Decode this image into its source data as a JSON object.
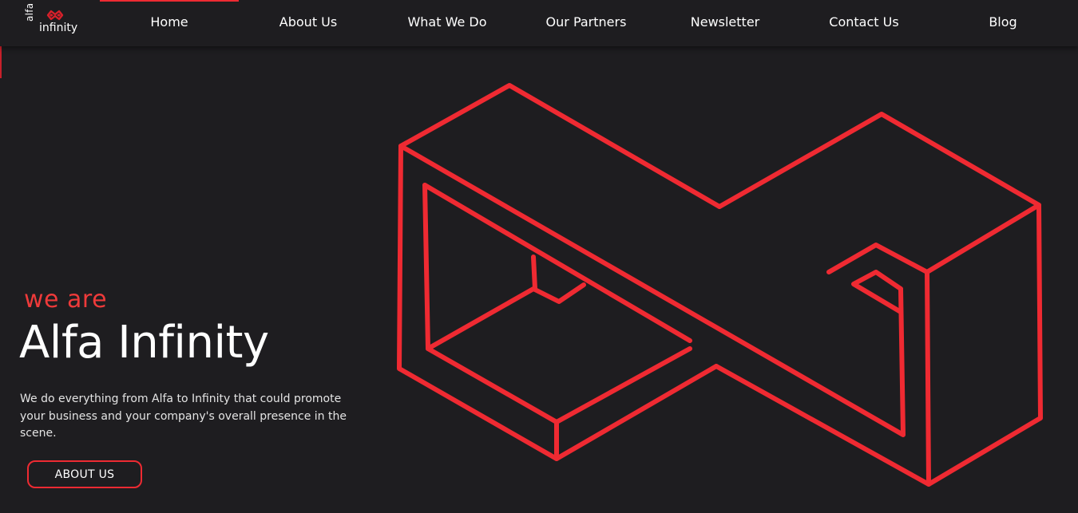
{
  "brand": {
    "logo_top": "alfa",
    "logo_bottom": "infinity",
    "accent_color": "#ee2a32",
    "background_color": "#1e1d20",
    "logo_icon": "infinity-icon"
  },
  "nav": {
    "items": [
      {
        "label": "Home",
        "active": true
      },
      {
        "label": "About Us",
        "active": false
      },
      {
        "label": "What We Do",
        "active": false
      },
      {
        "label": "Our Partners",
        "active": false
      },
      {
        "label": "Newsletter",
        "active": false
      },
      {
        "label": "Contact Us",
        "active": false
      },
      {
        "label": "Blog",
        "active": false
      }
    ]
  },
  "hero": {
    "eyebrow": "we are",
    "title": "Alfa Infinity",
    "description": "We do everything from Alfa to Infinity that could promote your business and your company's overall presence in the scene.",
    "cta_label": "ABOUT US",
    "illustration": "isometric-infinity-outline"
  }
}
